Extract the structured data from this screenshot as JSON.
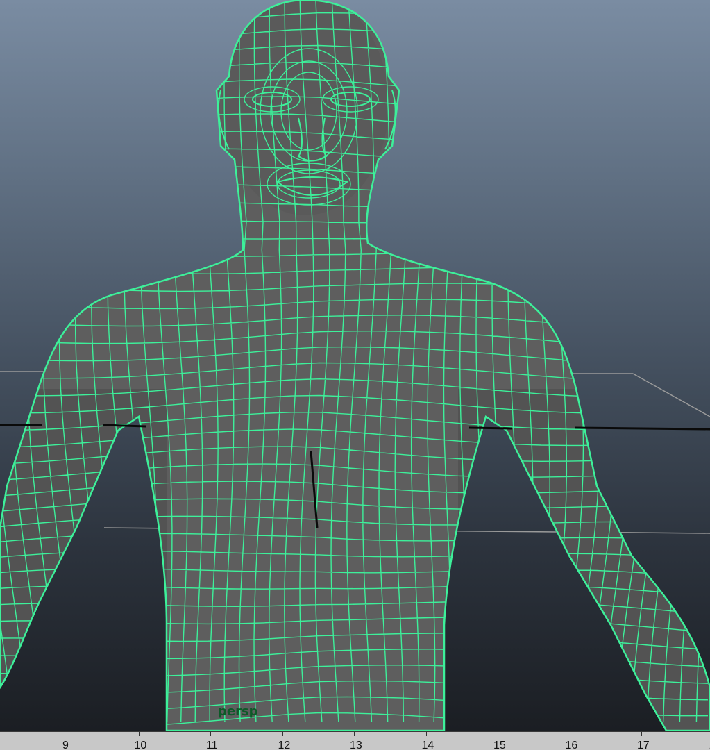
{
  "viewport": {
    "camera_label": "persp",
    "background_top": "#7a8ca2",
    "background_bottom": "#1b1e23",
    "wireframe_color": "#3df09a",
    "mesh_fill": "#606060"
  },
  "timeline": {
    "ticks": [
      "9",
      "10",
      "11",
      "12",
      "13",
      "14",
      "15",
      "16",
      "17",
      "1"
    ]
  }
}
